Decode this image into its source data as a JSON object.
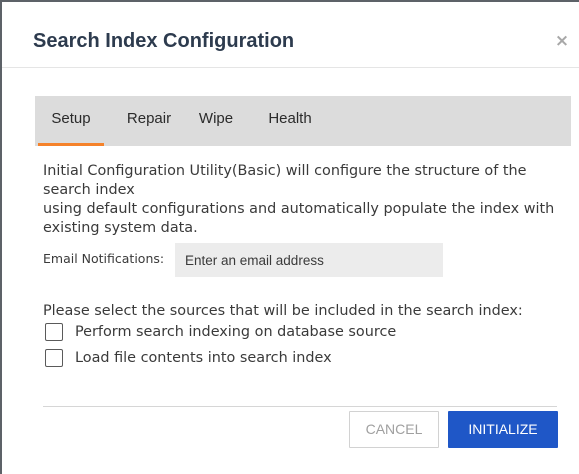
{
  "dialog": {
    "title": "Search Index Configuration",
    "close_glyph": "×"
  },
  "tabs": [
    {
      "label": "Setup",
      "active": true
    },
    {
      "label": "Repair",
      "active": false
    },
    {
      "label": "Wipe",
      "active": false
    },
    {
      "label": "Health",
      "active": false
    }
  ],
  "setup": {
    "intro_lines": [
      "Initial Configuration Utility(Basic) will configure the structure of the",
      "search index",
      "using default configurations and automatically populate the index with",
      "existing system data."
    ],
    "email": {
      "label": "Email Notifications:",
      "value": "",
      "placeholder": "Enter an email address"
    },
    "sources_title": "Please select the sources that will be included in the search index:",
    "sources": [
      {
        "label": "Perform search indexing on database source",
        "checked": false
      },
      {
        "label": "Load file contents into search index",
        "checked": false
      }
    ]
  },
  "footer": {
    "cancel_label": "CANCEL",
    "initialize_label": "INITIALIZE"
  },
  "colors": {
    "title": "#2d3b4e",
    "tab_active_underline": "#f5822a",
    "tab_bar_bg": "#dcdcdc",
    "primary_button": "#1f57c7"
  }
}
